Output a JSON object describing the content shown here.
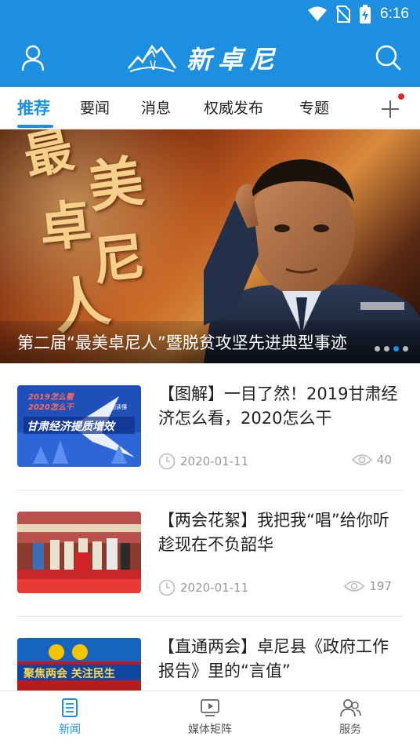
{
  "status_bar": {
    "time": "6:16"
  },
  "header": {
    "brand": "新卓尼",
    "accent_color": "#1d8fe0"
  },
  "tabs": [
    {
      "label": "推荐",
      "active": true
    },
    {
      "label": "要闻"
    },
    {
      "label": "消息"
    },
    {
      "label": "权威发布"
    },
    {
      "label": "专题"
    }
  ],
  "banner": {
    "title_art": "最美卓尼人",
    "caption": "第二届“最美卓尼人”暨脱贫攻坚先进典型事迹",
    "slide_count": 4,
    "active_slide": 3
  },
  "thumb1": {
    "line1": "2019怎么看",
    "line2": "2020怎么干",
    "tag": "一图读懂",
    "headline": "甘肃经济提质增效"
  },
  "thumb3": {
    "headline": "聚焦两会 关注民生"
  },
  "news": [
    {
      "title": "【图解】一目了然！2019甘肃经济怎么看，2020怎么干",
      "date": "2020-01-11",
      "views": "40"
    },
    {
      "title": "【两会花絮】我把我“唱”给你听 趁现在不负韶华",
      "date": "2020-01-11",
      "views": "197"
    },
    {
      "title": "【直通两会】卓尼县《政府工作报告》里的“言值”",
      "date": "",
      "views": ""
    }
  ],
  "bottom_nav": [
    {
      "label": "新闻",
      "icon": "news-icon",
      "active": true
    },
    {
      "label": "媒体矩阵",
      "icon": "play-screen-icon"
    },
    {
      "label": "服务",
      "icon": "people-icon"
    }
  ]
}
